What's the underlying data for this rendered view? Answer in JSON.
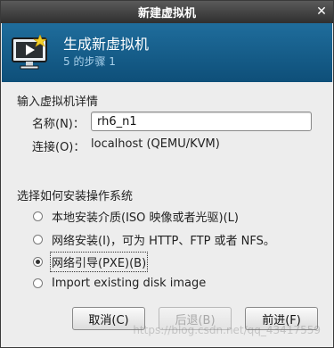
{
  "window": {
    "title": "新建虚拟机"
  },
  "banner": {
    "title": "生成新虚拟机",
    "step": "5 的步骤 1"
  },
  "details": {
    "heading": "输入虚拟机详情",
    "name_label": "名称(N)：",
    "name_value": "rh6_n1",
    "connection_label": "连接(O)：",
    "connection_value": "localhost (QEMU/KVM)"
  },
  "install": {
    "heading": "选择如何安装操作系统",
    "options": [
      {
        "label": "本地安装介质(ISO 映像或者光驱)(L)",
        "checked": false
      },
      {
        "label": "网络安装(I)，可为 HTTP、FTP 或者 NFS。",
        "checked": false
      },
      {
        "label": "网络引导(PXE)(B)",
        "checked": true
      },
      {
        "label": "Import existing disk image",
        "checked": false
      }
    ]
  },
  "buttons": {
    "cancel": "取消(C)",
    "back": "后退(B)",
    "forward": "前进(F)"
  },
  "watermark": "https://blog.csdn.net/qq_43417559"
}
